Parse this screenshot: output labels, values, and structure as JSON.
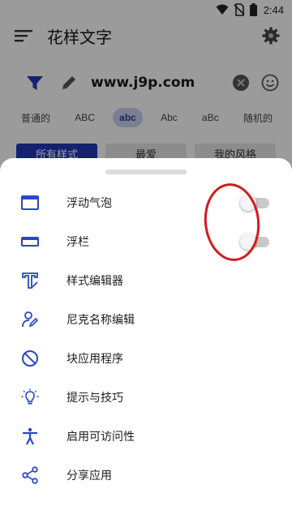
{
  "status_bar": {
    "time": "2:44"
  },
  "app_bar": {
    "title": "花样文字"
  },
  "input": {
    "text": "www.j9p.com"
  },
  "style_tabs": [
    "普通的",
    "ABC",
    "abc",
    "Abc",
    "aBc",
    "随机的"
  ],
  "style_tabs_active_index": 2,
  "categories": [
    "所有样式",
    "最爱",
    "我的风格"
  ],
  "sheet": {
    "items": [
      {
        "label": "浮动气泡",
        "icon": "window-icon",
        "toggle": false
      },
      {
        "label": "浮栏",
        "icon": "bar-icon",
        "toggle": false
      },
      {
        "label": "样式编辑器",
        "icon": "text-format-icon"
      },
      {
        "label": "尼克名称编辑",
        "icon": "person-edit-icon"
      },
      {
        "label": "块应用程序",
        "icon": "block-icon"
      },
      {
        "label": "提示与技巧",
        "icon": "lightbulb-icon"
      },
      {
        "label": "启用可访问性",
        "icon": "accessibility-icon"
      },
      {
        "label": "分享应用",
        "icon": "share-icon"
      }
    ]
  },
  "colors": {
    "accent": "#2337b5",
    "icon_blue": "#2a46c8",
    "highlight": "#d41a1a"
  }
}
